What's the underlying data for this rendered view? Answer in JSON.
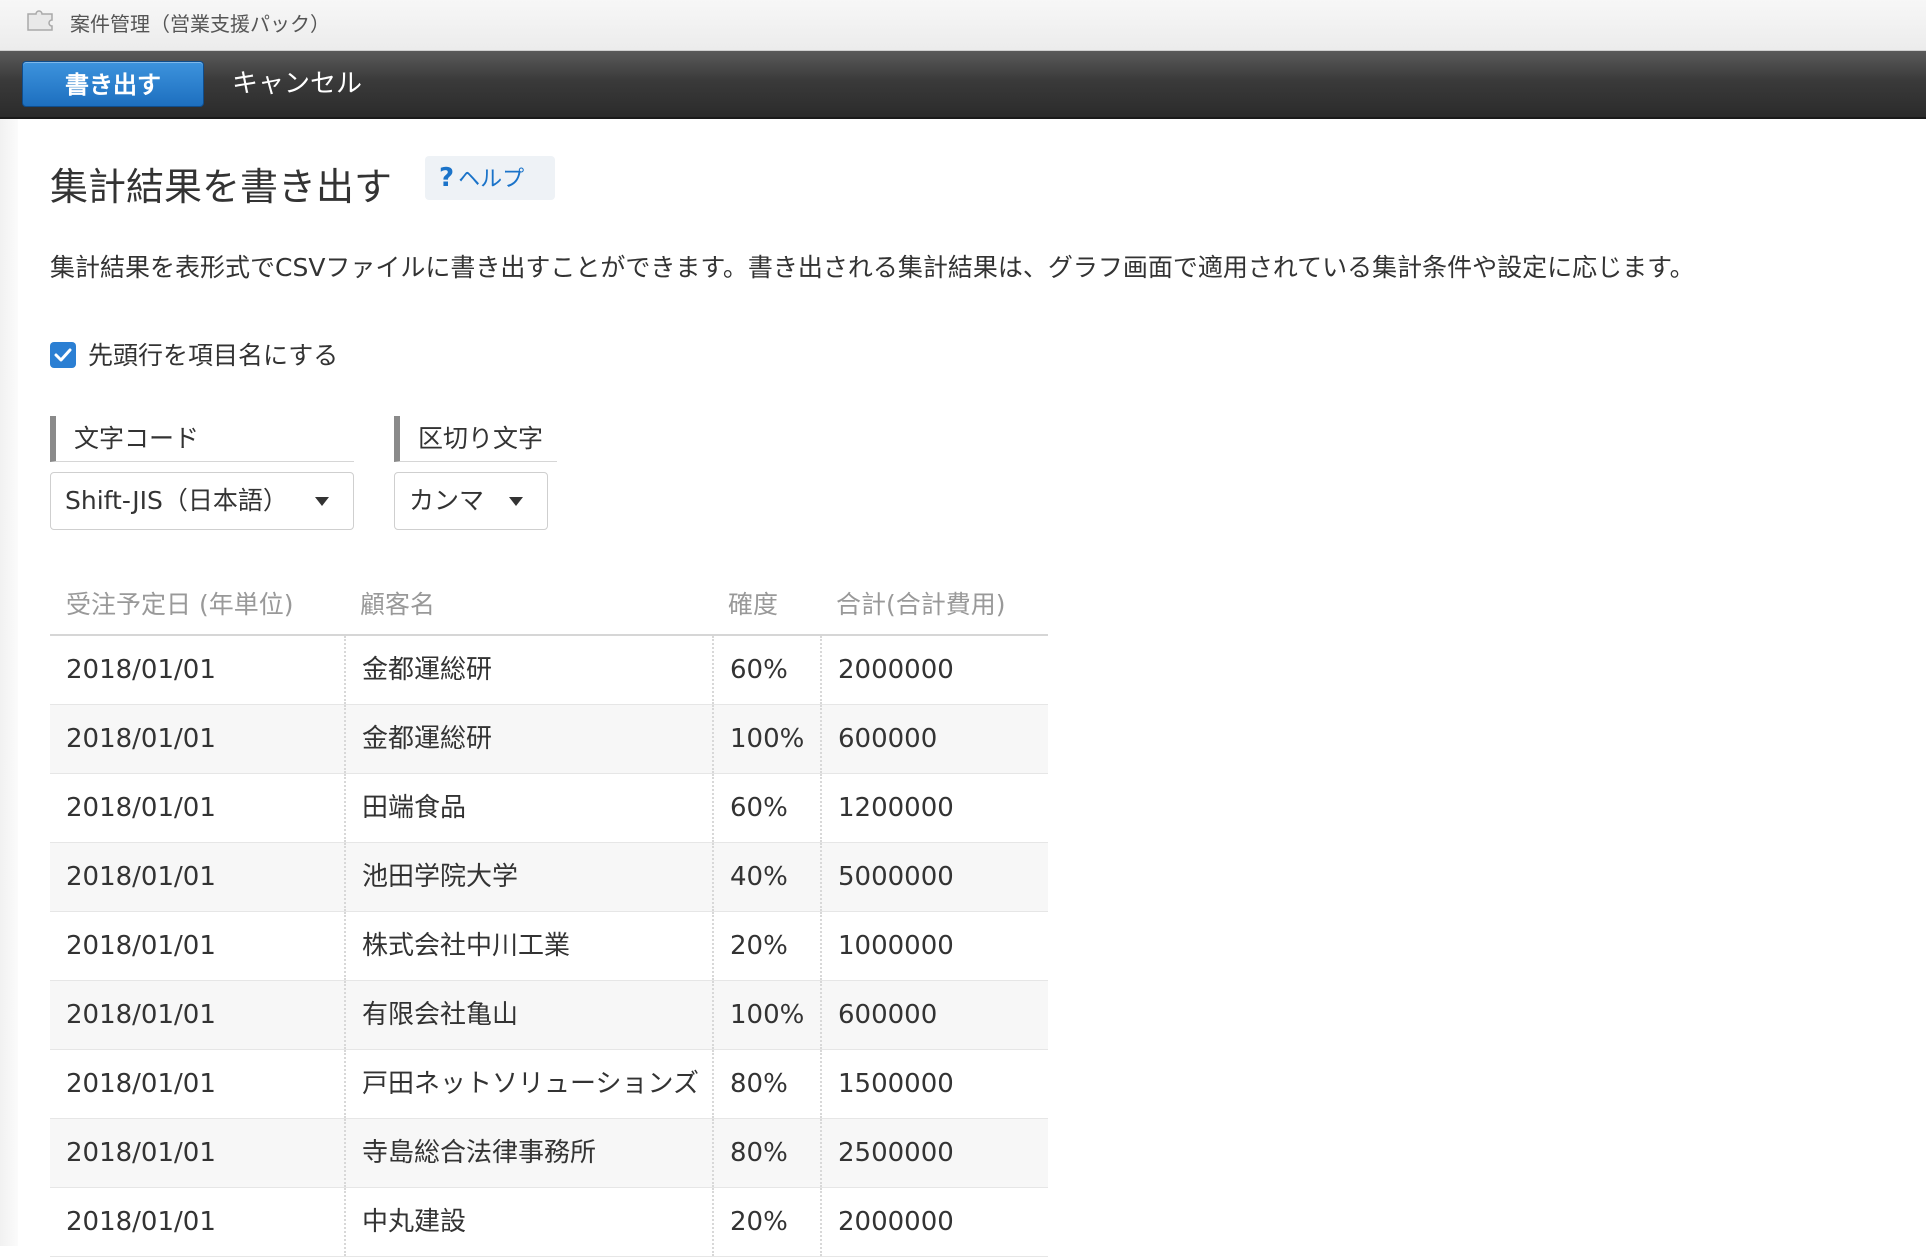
{
  "window": {
    "app_title": "案件管理（営業支援パック）"
  },
  "toolbar": {
    "export_label": "書き出す",
    "cancel_label": "キャンセル"
  },
  "page": {
    "title": "集計結果を書き出す",
    "help_label": "ヘルプ",
    "help_mark": "?",
    "description": "集計結果を表形式でCSVファイルに書き出すことができます。書き出される集計結果は、グラフ画面で適用されている集計条件や設定に応じます。"
  },
  "options": {
    "header_row_label": "先頭行を項目名にする",
    "header_row_checked": true,
    "encoding": {
      "label": "文字コード",
      "value": "Shift-JIS（日本語）"
    },
    "delimiter": {
      "label": "区切り文字",
      "value": "カンマ"
    }
  },
  "table": {
    "columns": [
      "受注予定日 (年単位)",
      "顧客名",
      "確度",
      "合計(合計費用)"
    ],
    "rows": [
      [
        "2018/01/01",
        "金都運総研",
        "60%",
        "2000000"
      ],
      [
        "2018/01/01",
        "金都運総研",
        "100%",
        "600000"
      ],
      [
        "2018/01/01",
        "田端食品",
        "60%",
        "1200000"
      ],
      [
        "2018/01/01",
        "池田学院大学",
        "40%",
        "5000000"
      ],
      [
        "2018/01/01",
        "株式会社中川工業",
        "20%",
        "1000000"
      ],
      [
        "2018/01/01",
        "有限会社亀山",
        "100%",
        "600000"
      ],
      [
        "2018/01/01",
        "戸田ネットソリューションズ",
        "80%",
        "1500000"
      ],
      [
        "2018/01/01",
        "寺島総合法律事務所",
        "80%",
        "2500000"
      ],
      [
        "2018/01/01",
        "中丸建設",
        "20%",
        "2000000"
      ]
    ]
  },
  "colors": {
    "primary_button": "#1d6fbf",
    "toolbar": "#2b2b2b",
    "checkbox": "#2b7fd3",
    "help_text": "#1a73c9"
  }
}
